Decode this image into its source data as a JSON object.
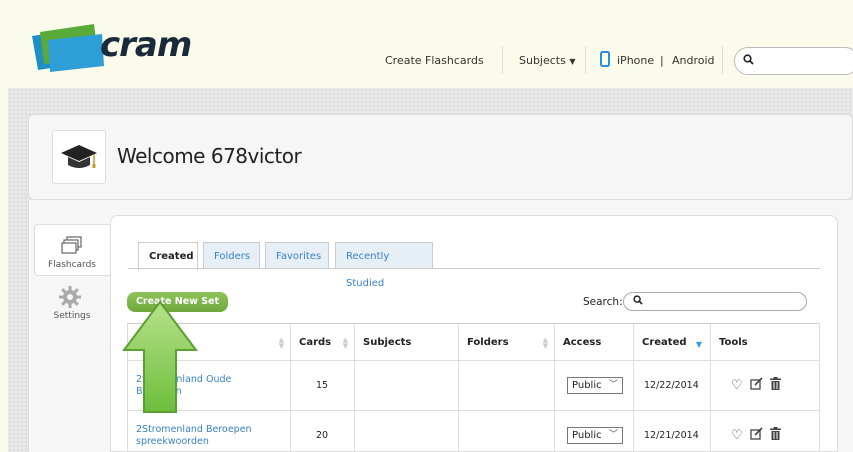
{
  "app": {
    "brand": "cram",
    "colors": {
      "background": "#fbfbeb",
      "accent_green": "#7ab648",
      "link_blue": "#3a83c4",
      "logo_blue": "#1d8fc4",
      "logo_green": "#5aaa3a"
    }
  },
  "header": {
    "create_flashcards": "Create Flashcards",
    "subjects": "Subjects",
    "subjects_icon": "caret-down-icon",
    "phone_icon": "mobile-phone-icon",
    "iphone": "iPhone",
    "separator": "|",
    "android": "Android",
    "search_icon": "search-icon"
  },
  "profile": {
    "welcome": "Welcome 678victor",
    "avatar_icon": "graduation-cap-icon"
  },
  "sidebar": {
    "items": [
      {
        "label": "Flashcards",
        "icon": "cards-stack-icon",
        "active": true
      },
      {
        "label": "Settings",
        "icon": "gear-icon",
        "active": false
      }
    ]
  },
  "tabs": [
    {
      "label": "Created",
      "active": true
    },
    {
      "label": "Folders",
      "active": false
    },
    {
      "label": "Favorites",
      "active": false
    },
    {
      "label": "Recently Studied",
      "active": false
    }
  ],
  "toolbar": {
    "create_new_set": "Create New Set",
    "search_label": "Search:"
  },
  "table": {
    "columns": [
      "",
      "Cards",
      "Subjects",
      "Folders",
      "Access",
      "Created",
      "Tools"
    ],
    "rows": [
      {
        "title_line1": "2Stromenland Oude",
        "title_line2": "Beroepen",
        "cards": "15",
        "subjects": "",
        "folders": "",
        "access": "Public",
        "created": "12/22/2014"
      },
      {
        "title_line1": "2Stromenland Beroepen",
        "title_line2": "spreekwoorden",
        "cards": "20",
        "subjects": "",
        "folders": "",
        "access": "Public",
        "created": "12/21/2014"
      }
    ],
    "tool_icons": [
      "heart-icon",
      "edit-icon",
      "trash-icon"
    ]
  },
  "annotation": {
    "arrow_icon": "green-up-arrow-icon"
  }
}
